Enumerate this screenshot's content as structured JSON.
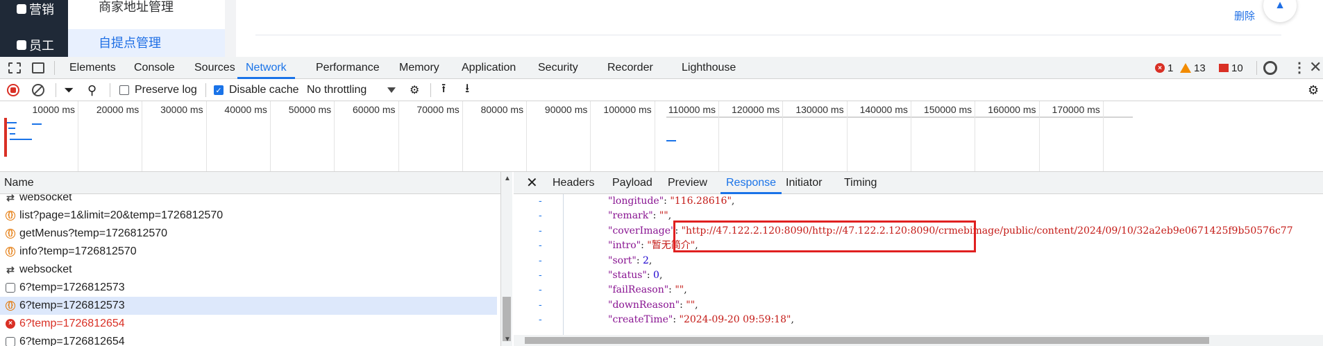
{
  "app": {
    "sidebar": [
      {
        "label": "营销"
      },
      {
        "label": "员工"
      }
    ],
    "submenu": [
      {
        "label": "商家地址管理"
      },
      {
        "label": "自提点管理"
      }
    ],
    "delete_link": "删除"
  },
  "devtools": {
    "tabs": [
      "Elements",
      "Console",
      "Sources",
      "Network",
      "Performance",
      "Memory",
      "Application",
      "Security",
      "Recorder",
      "Lighthouse"
    ],
    "active_tab": "Network",
    "counts": {
      "errors": "1",
      "warnings": "13",
      "issues": "10"
    },
    "toolbar": {
      "preserve_log": "Preserve log",
      "disable_cache": "Disable cache",
      "throttling": "No throttling"
    },
    "timeline_ticks": [
      "10000 ms",
      "20000 ms",
      "30000 ms",
      "40000 ms",
      "50000 ms",
      "60000 ms",
      "70000 ms",
      "80000 ms",
      "90000 ms",
      "100000 ms",
      "110000 ms",
      "120000 ms",
      "130000 ms",
      "140000 ms",
      "150000 ms",
      "160000 ms",
      "170000 ms"
    ],
    "request_list": {
      "header": "Name",
      "rows": [
        {
          "name": "websocket",
          "type": "ws",
          "status": "ok"
        },
        {
          "name": "list?page=1&limit=20&temp=1726812570",
          "type": "json",
          "status": "ok"
        },
        {
          "name": "getMenus?temp=1726812570",
          "type": "json",
          "status": "ok"
        },
        {
          "name": "info?temp=1726812570",
          "type": "json",
          "status": "ok"
        },
        {
          "name": "websocket",
          "type": "ws",
          "status": "ok"
        },
        {
          "name": "6?temp=1726812573",
          "type": "doc",
          "status": "ok"
        },
        {
          "name": "6?temp=1726812573",
          "type": "json",
          "status": "selected"
        },
        {
          "name": "6?temp=1726812654",
          "type": "error",
          "status": "error"
        },
        {
          "name": "6?temp=1726812654",
          "type": "doc",
          "status": "ok"
        }
      ]
    },
    "detail_tabs": [
      "Headers",
      "Payload",
      "Preview",
      "Response",
      "Initiator",
      "Timing"
    ],
    "detail_active": "Response",
    "response_lines": [
      {
        "key": "\"longitude\"",
        "value": "\"116.28616\"",
        "vtype": "s",
        "trail": ","
      },
      {
        "key": "\"remark\"",
        "value": "\"\"",
        "vtype": "s",
        "trail": ","
      },
      {
        "key": "\"coverImage\"",
        "value": "\"http://47.122.2.120:8090/http://47.122.2.120:8090/crmebimage/public/content/2024/09/10/32a2eb9e0671425f9b50576c77",
        "vtype": "s",
        "trail": ""
      },
      {
        "key": "\"intro\"",
        "value": "\"暂无简介\"",
        "vtype": "s",
        "trail": ","
      },
      {
        "key": "\"sort\"",
        "value": "2",
        "vtype": "n",
        "trail": ","
      },
      {
        "key": "\"status\"",
        "value": "0",
        "vtype": "n",
        "trail": ","
      },
      {
        "key": "\"failReason\"",
        "value": "\"\"",
        "vtype": "s",
        "trail": ","
      },
      {
        "key": "\"downReason\"",
        "value": "\"\"",
        "vtype": "s",
        "trail": ","
      },
      {
        "key": "\"createTime\"",
        "value": "\"2024-09-20 09:59:18\"",
        "vtype": "s",
        "trail": ","
      }
    ],
    "gutter_mark": "-",
    "highlight_color": "#e02020",
    "accent": "#1a73e8"
  }
}
